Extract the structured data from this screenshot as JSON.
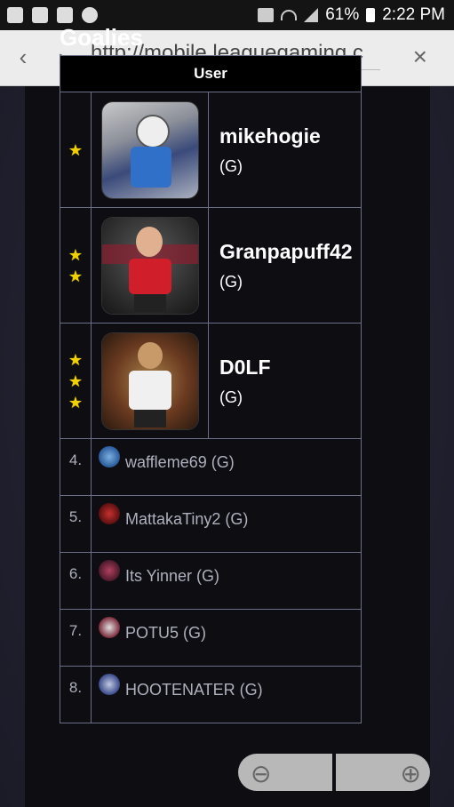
{
  "status_bar": {
    "battery": "61%",
    "time": "2:22 PM"
  },
  "browser": {
    "url": "http://mobile.leaguegaming.c"
  },
  "section_title": "Goalies",
  "table": {
    "header": "User",
    "featured": [
      {
        "name": "mikehogie",
        "pos": "(G)"
      },
      {
        "name": "Granpapuff42",
        "pos": "(G)"
      },
      {
        "name": "D0LF",
        "pos": "(G)"
      }
    ],
    "others": [
      {
        "rank": "4.",
        "name": "waffleme69 (G)"
      },
      {
        "rank": "5.",
        "name": "MattakaTiny2 (G)"
      },
      {
        "rank": "6.",
        "name": "Its Yinner (G)"
      },
      {
        "rank": "7.",
        "name": "POTU5 (G)"
      },
      {
        "rank": "8.",
        "name": "HOOTENATER (G)"
      }
    ]
  }
}
